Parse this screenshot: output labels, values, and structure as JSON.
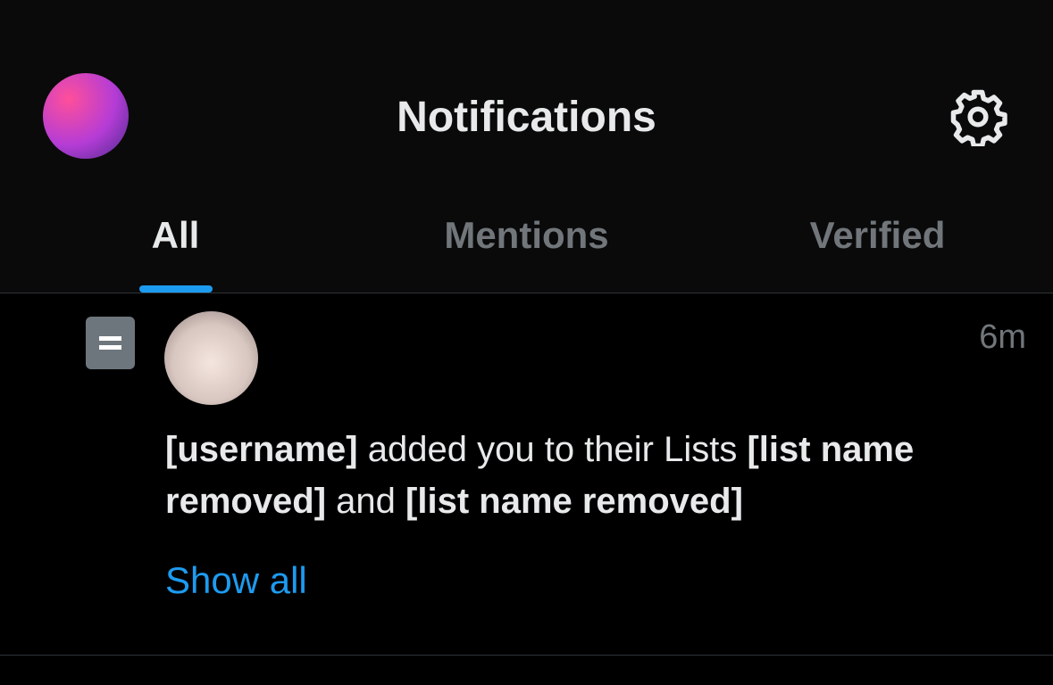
{
  "header": {
    "title": "Notifications"
  },
  "tabs": [
    {
      "label": "All",
      "active": true
    },
    {
      "label": "Mentions",
      "active": false
    },
    {
      "label": "Verified",
      "active": false
    }
  ],
  "notification": {
    "time": "6m",
    "actor": "[username]",
    "action": "added you to their Lists",
    "list_1": "[list name removed]",
    "joiner": "and",
    "list_2": "[list name removed]",
    "show_all": "Show all"
  },
  "colors": {
    "accent": "#1d9bf0",
    "muted": "#71767b",
    "text": "#e7e9ea",
    "bg": "#000000"
  },
  "icons": {
    "settings": "gear-icon",
    "list": "list-icon"
  }
}
